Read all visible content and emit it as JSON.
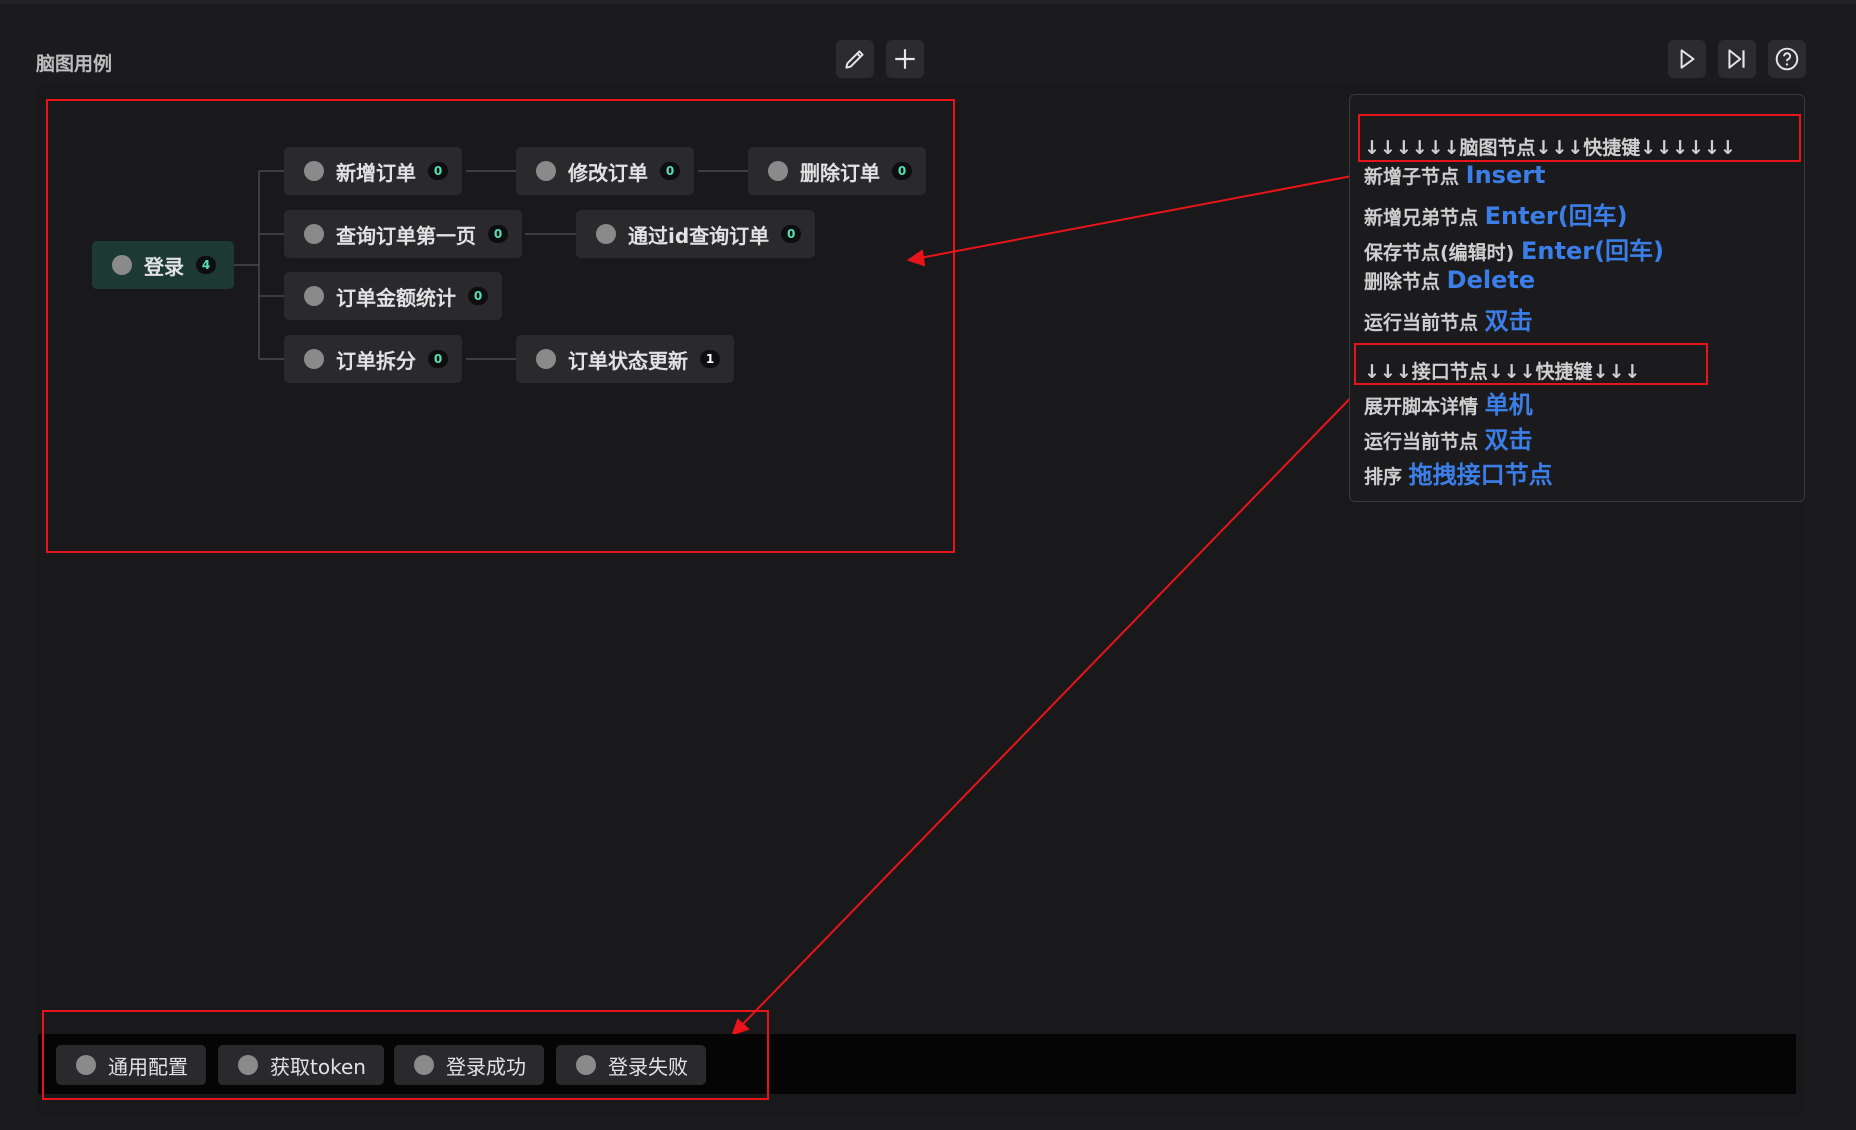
{
  "header": {
    "title": "脑图用例"
  },
  "toolbar": {
    "edit_icon": "pencil-icon",
    "add_icon": "plus-icon",
    "run_icon": "play-icon",
    "step_icon": "step-forward-icon",
    "help_icon": "help-circle-icon"
  },
  "mindmap": {
    "root": {
      "label": "登录",
      "count": "4"
    },
    "nodes": [
      {
        "label": "新增订单",
        "count": "0"
      },
      {
        "label": "修改订单",
        "count": "0"
      },
      {
        "label": "删除订单",
        "count": "0"
      },
      {
        "label": "查询订单第一页",
        "count": "0"
      },
      {
        "label": "通过id查询订单",
        "count": "0"
      },
      {
        "label": "订单金额统计",
        "count": "0"
      },
      {
        "label": "订单拆分",
        "count": "0"
      },
      {
        "label": "订单状态更新",
        "count": "1"
      }
    ]
  },
  "help": {
    "mind_header": "↓↓↓↓↓↓脑图节点↓↓↓快捷键↓↓↓↓↓↓",
    "mind_items": [
      {
        "label": "新增子节点",
        "key": "Insert"
      },
      {
        "label": "新增兄弟节点",
        "key": "Enter(回车)"
      },
      {
        "label": "保存节点(编辑时)",
        "key": "Enter(回车)"
      },
      {
        "label": "删除节点",
        "key": "Delete"
      },
      {
        "label": "运行当前节点",
        "key": "双击"
      }
    ],
    "api_header": "↓↓↓接口节点↓↓↓快捷键↓↓↓",
    "api_items": [
      {
        "label": "展开脚本详情",
        "key": "单机"
      },
      {
        "label": "运行当前节点",
        "key": "双击"
      },
      {
        "label": "排序",
        "key": "拖拽接口节点"
      }
    ]
  },
  "bottom_nodes": [
    {
      "label": "通用配置"
    },
    {
      "label": "获取token"
    },
    {
      "label": "登录成功"
    },
    {
      "label": "登录失败"
    }
  ],
  "colors": {
    "accent": "#3c7ee8",
    "badge_text": "#54e0b6",
    "annotation": "#e8141a",
    "root_bg": "#1d3a32"
  }
}
